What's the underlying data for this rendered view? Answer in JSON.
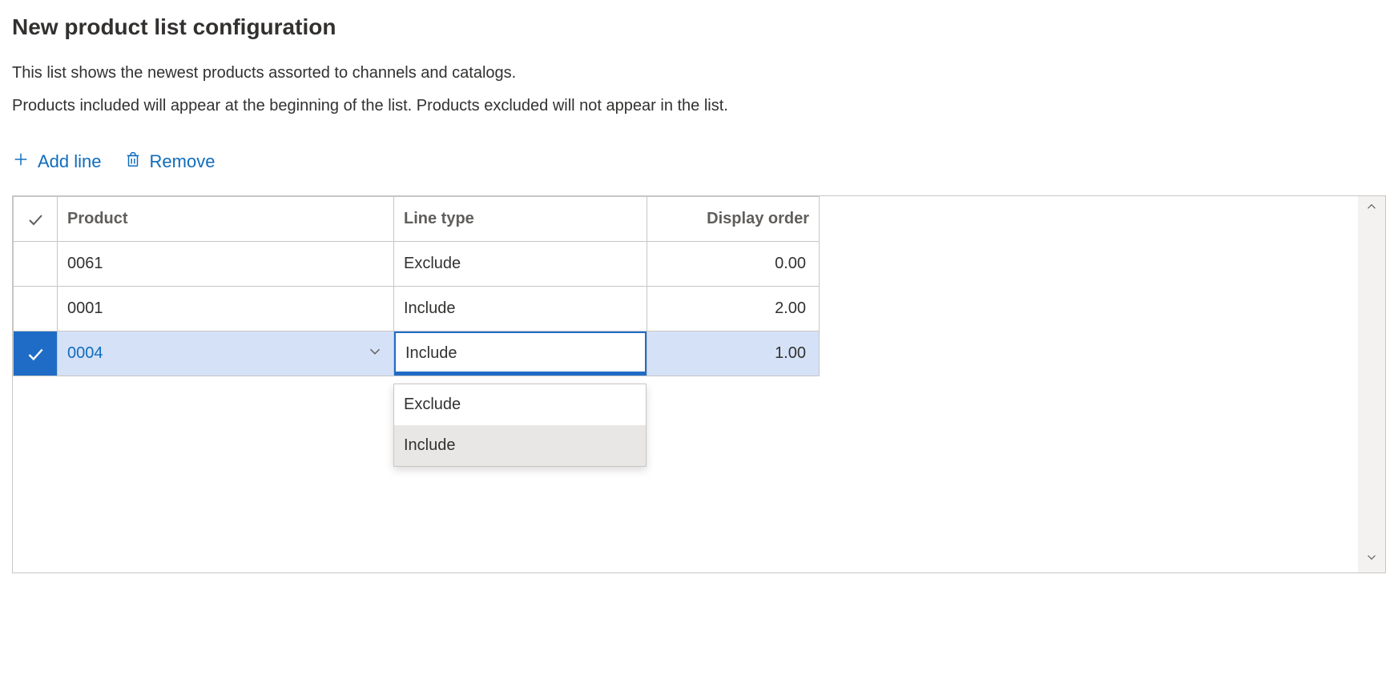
{
  "title": "New product list configuration",
  "description_line1": "This list shows the newest products assorted to channels and catalogs.",
  "description_line2": "Products included will appear at the beginning of the list. Products excluded will not appear in the list.",
  "toolbar": {
    "add_label": "Add line",
    "remove_label": "Remove"
  },
  "grid": {
    "headers": {
      "product": "Product",
      "line_type": "Line type",
      "display_order": "Display order"
    },
    "rows": [
      {
        "product": "0061",
        "line_type": "Exclude",
        "display_order": "0.00",
        "selected": false
      },
      {
        "product": "0001",
        "line_type": "Include",
        "display_order": "2.00",
        "selected": false
      },
      {
        "product": "0004",
        "line_type": "Include",
        "display_order": "1.00",
        "selected": true
      }
    ]
  },
  "line_type_dropdown": {
    "options": [
      "Exclude",
      "Include"
    ],
    "highlighted": "Include"
  }
}
